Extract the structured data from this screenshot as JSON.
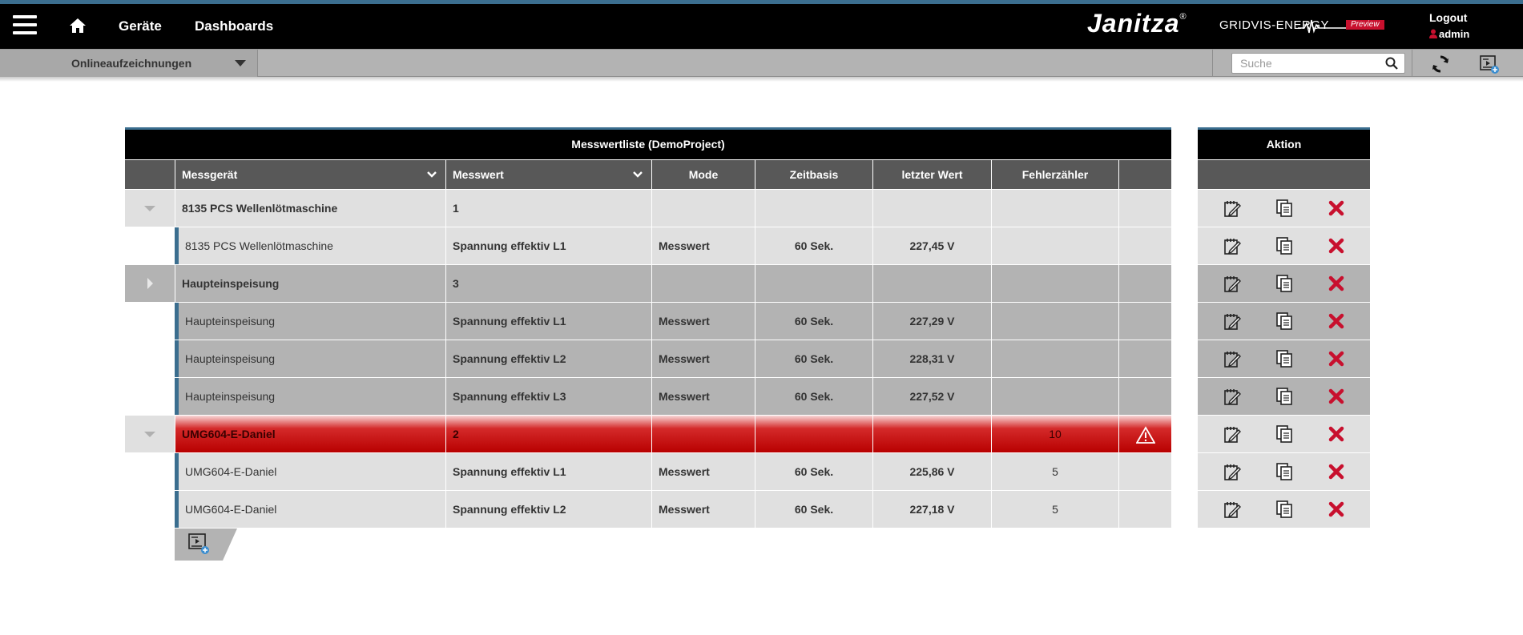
{
  "header": {
    "nav": [
      "Geräte",
      "Dashboards"
    ],
    "brand": "Janitza",
    "brand_mark": "®",
    "product": "GRIDVIS-ENERGY",
    "preview_badge": "Preview",
    "logout": "Logout",
    "user": "admin"
  },
  "toolbar": {
    "view_select": "Onlineaufzeichnungen",
    "search_placeholder": "Suche"
  },
  "table": {
    "title": "Messwertliste (DemoProject)",
    "columns": [
      "Messgerät",
      "Messwert",
      "Mode",
      "Zeitbasis",
      "letzter Wert",
      "Fehlerzähler"
    ],
    "rows": [
      {
        "type": "group",
        "expanded": true,
        "shade": "light",
        "device": "8135 PCS Wellenlötmaschine",
        "value": "1",
        "mode": "",
        "timebase": "",
        "last": "",
        "errors": ""
      },
      {
        "type": "child",
        "shade": "light",
        "device": "8135 PCS Wellenlötmaschine",
        "value": "Spannung effektiv L1",
        "mode": "Messwert",
        "timebase": "60 Sek.",
        "last": "227,45 V",
        "errors": ""
      },
      {
        "type": "group",
        "expanded": false,
        "shade": "dark",
        "device": "Haupteinspeisung",
        "value": "3",
        "mode": "",
        "timebase": "",
        "last": "",
        "errors": ""
      },
      {
        "type": "child",
        "shade": "dark",
        "device": "Haupteinspeisung",
        "value": "Spannung effektiv L1",
        "mode": "Messwert",
        "timebase": "60 Sek.",
        "last": "227,29 V",
        "errors": ""
      },
      {
        "type": "child",
        "shade": "dark",
        "device": "Haupteinspeisung",
        "value": "Spannung effektiv L2",
        "mode": "Messwert",
        "timebase": "60 Sek.",
        "last": "228,31 V",
        "errors": ""
      },
      {
        "type": "child",
        "shade": "dark",
        "device": "Haupteinspeisung",
        "value": "Spannung effektiv L3",
        "mode": "Messwert",
        "timebase": "60 Sek.",
        "last": "227,52 V",
        "errors": ""
      },
      {
        "type": "group",
        "expanded": true,
        "shade": "alarm",
        "device": "UMG604-E-Daniel",
        "value": "2",
        "mode": "",
        "timebase": "",
        "last": "",
        "errors": "10"
      },
      {
        "type": "child",
        "shade": "light",
        "device": "UMG604-E-Daniel",
        "value": "Spannung effektiv L1",
        "mode": "Messwert",
        "timebase": "60 Sek.",
        "last": "225,86 V",
        "errors": "5"
      },
      {
        "type": "child",
        "shade": "light",
        "device": "UMG604-E-Daniel",
        "value": "Spannung effektiv L2",
        "mode": "Messwert",
        "timebase": "60 Sek.",
        "last": "227,18 V",
        "errors": "5"
      }
    ]
  },
  "actions": {
    "title": "Aktion",
    "icons": [
      "edit-icon",
      "copy-icon",
      "delete-icon"
    ]
  },
  "colors": {
    "accent": "#3b6e8f",
    "alarm": "#b80000",
    "delete": "#c8102e",
    "header_bg": "#000000",
    "column_header_bg": "#585858"
  }
}
